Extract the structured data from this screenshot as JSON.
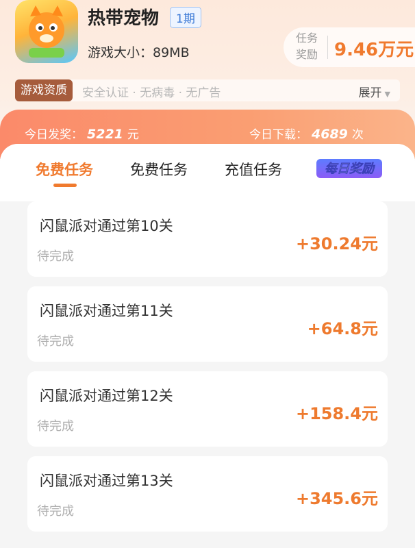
{
  "app": {
    "title": "热带宠物",
    "period": "1期",
    "size_text": "游戏大小：89MB",
    "reward_label": "任务奖励",
    "reward_value": "9.46万元"
  },
  "qualification": {
    "tag": "游戏资质",
    "text": "安全认证 · 无病毒 · 无广告",
    "expand": "展开"
  },
  "stats": {
    "payout_label": "今日发奖：",
    "payout_value": "5221",
    "payout_unit": "元",
    "download_label": "今日下载：",
    "download_value": "4689",
    "download_unit": "次"
  },
  "tabs": {
    "free1": "免费任务",
    "free2": "免费任务",
    "recharge": "充值任务",
    "daily": "每日奖励"
  },
  "tasks": [
    {
      "title": "闪鼠派对通过第10关",
      "status": "待完成",
      "reward": "+30.24元"
    },
    {
      "title": "闪鼠派对通过第11关",
      "status": "待完成",
      "reward": "+64.8元"
    },
    {
      "title": "闪鼠派对通过第12关",
      "status": "待完成",
      "reward": "+158.4元"
    },
    {
      "title": "闪鼠派对通过第13关",
      "status": "待完成",
      "reward": "+345.6元"
    }
  ],
  "colors": {
    "accent": "#f07a2e",
    "band": "#fb8a6a"
  }
}
